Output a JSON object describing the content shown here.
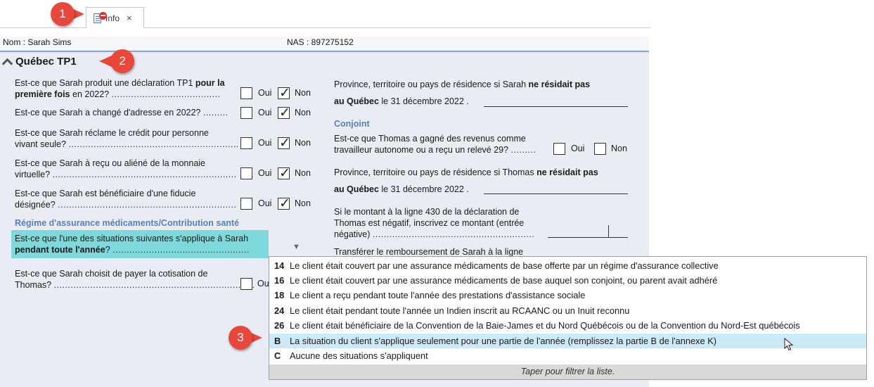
{
  "tab": {
    "label": "Info",
    "close": "×"
  },
  "header": {
    "nom": "Nom : Sarah Sims",
    "nas": "NAS : 897275152"
  },
  "section": {
    "title": "Québec TP1"
  },
  "left": {
    "q1_line1_a": "Est-ce que Sarah produit une déclaration TP1 ",
    "q1_line1_b": "pour la",
    "q1_line2_a": "première fois",
    "q1_line2_b": " en 2022? ",
    "q2": "Est-ce que Sarah a changé d'adresse en 2022? ",
    "q3_line1": "Est-ce que Sarah réclame le crédit pour personne",
    "q3_line2": "vivant seule? ",
    "q4_line1": "Est-ce que Sarah à reçu ou aliéné de la monnaie",
    "q4_line2": "virtuelle? ",
    "q5_line1": "Est-ce que Sarah est bénéficiaire d'une fiducie",
    "q5_line2": "désignée? ",
    "regime_title": "Régime d'assurance médicaments/Contribution santé",
    "q6_line1": "Est-ce que l'une des situations suivantes s'applique à Sarah",
    "q6_line2": "pendant toute l'année",
    "q6_line2_b": "? ",
    "q7_line1": "Est-ce que Sarah choisit de payer la cotisation de",
    "q7_line2": "Thomas? ",
    "oui": "Oui",
    "non": "Non",
    "ou_partial": "Ou"
  },
  "right": {
    "p1_line1_a": "Province, territoire ou pays de résidence si Sarah ",
    "p1_line1_b": "ne résidait pas",
    "p1_line2_a": "au Québec",
    "p1_line2_b": " le 31 décembre 2022  .",
    "conjoint": "Conjoint",
    "c1_line1": "Est-ce que Thomas a gagné des revenus comme",
    "c1_line2": "travailleur autonome ou a reçu un relevé 29? ",
    "p2_line1_a": "Province, territoire ou pays de résidence si Thomas ",
    "p2_line1_b": "ne résidait pas",
    "p2_line2_a": "au Québec",
    "p2_line2_b": " le 31 décembre 2022  .",
    "m_line1": "Si le montant à la ligne 430 de la déclaration de",
    "m_line2": "Thomas est négatif, inscrivez ce montant (entrée",
    "m_line3": "négative) ",
    "t_line1": "Transférer le remboursement de Sarah à la ligne",
    "oui": "Oui",
    "non": "Non"
  },
  "dropdown": {
    "items": [
      {
        "code": "14",
        "text": "Le client était couvert par une assurance médicaments de base offerte par un régime d'assurance collective"
      },
      {
        "code": "16",
        "text": "Le client était couvert par une assurance médicaments de base auquel son conjoint, ou parent avait adhéré"
      },
      {
        "code": "18",
        "text": "Le client a reçu pendant toute l'année des prestations d'assistance sociale"
      },
      {
        "code": "24",
        "text": "Le client était pendant toute l'année un Indien inscrit au RCAANC ou un Inuit reconnu"
      },
      {
        "code": "26",
        "text": "Le client était bénéficiaire de la Convention de la Baie-James et du Nord Québécois ou de la Convention du Nord-Est québécois"
      },
      {
        "code": "B",
        "text": "La situation du client s'applique seulement pour une partie de l'année (remplissez la partie B de l'annexe K)"
      },
      {
        "code": "C",
        "text": "Aucune des situations s'appliquent"
      }
    ],
    "footer": "Taper pour filtrer la liste."
  },
  "callouts": {
    "c1": "1",
    "c2": "2",
    "c3": "3"
  },
  "colors": {
    "callout": "#e8483b",
    "highlight": "#7ed9dd",
    "subhead": "#5b7fb0",
    "selected": "#cde8f6"
  }
}
